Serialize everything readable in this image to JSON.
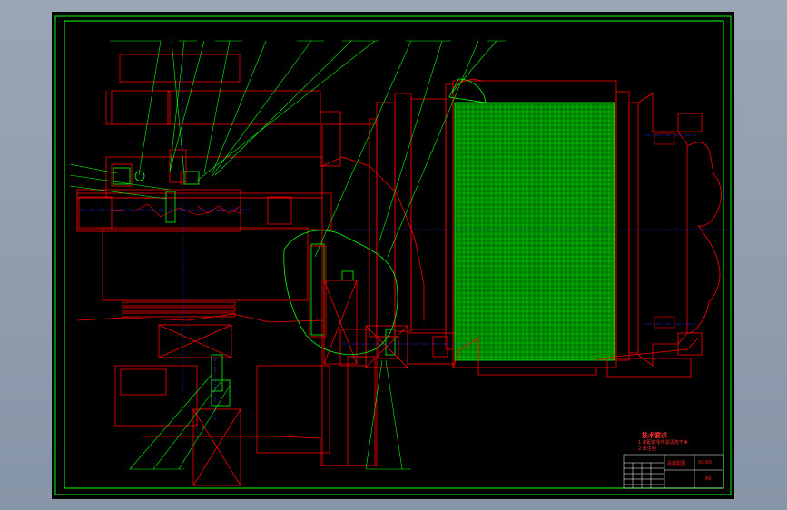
{
  "colors": {
    "background": "#000000",
    "frame": "#00ff00",
    "outline": "#ff0000",
    "centerline": "#0000ff",
    "hatch": "#00ff00",
    "leader": "#00ff00",
    "desktop": "#8f9cb0"
  },
  "title_block": {
    "heading": "技术要求",
    "note_line1": "1.装配前零件需清洗干净",
    "note_line2": "2.未注明",
    "drawing_name": "总装配图",
    "drawing_no": "XX-00",
    "sheet_mark": "A0"
  }
}
